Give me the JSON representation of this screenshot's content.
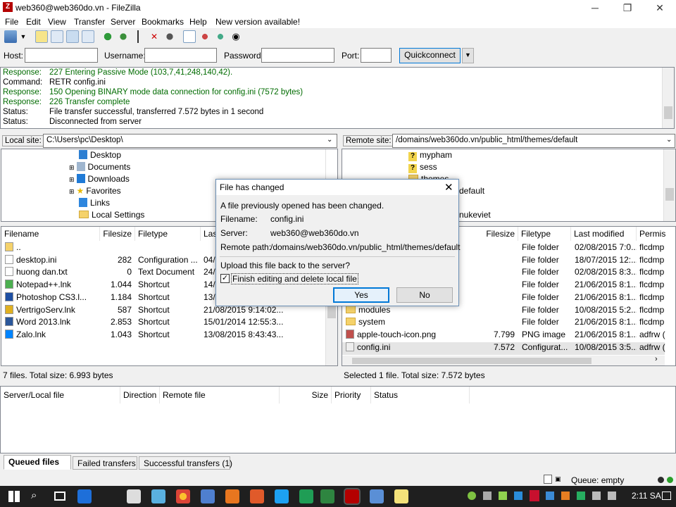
{
  "window": {
    "title": "web360@web360do.vn - FileZilla",
    "controls": [
      "─",
      "❐",
      "✕"
    ]
  },
  "menu": [
    "File",
    "Edit",
    "View",
    "Transfer",
    "Server",
    "Bookmarks",
    "Help",
    "New version available!"
  ],
  "quickconnect": {
    "host_label": "Host:",
    "username_label": "Username:",
    "password_label": "Password:",
    "port_label": "Port:",
    "button": "Quickconnect",
    "host": "",
    "username": "",
    "password": "",
    "port": ""
  },
  "log": [
    {
      "k": "Response:",
      "v": "227 Entering Passive Mode (103,7,41,248,140,42).",
      "green": true
    },
    {
      "k": "Command:",
      "v": "RETR config.ini",
      "green": false
    },
    {
      "k": "Response:",
      "v": "150 Opening BINARY mode data connection for config.ini (7572 bytes)",
      "green": true
    },
    {
      "k": "Response:",
      "v": "226 Transfer complete",
      "green": true
    },
    {
      "k": "Status:",
      "v": "File transfer successful, transferred 7.572 bytes in 1 second",
      "green": false
    },
    {
      "k": "Status:",
      "v": "Disconnected from server",
      "green": false
    }
  ],
  "local": {
    "label": "Local site:",
    "path": "C:\\Users\\pc\\Desktop\\",
    "tree": [
      "Desktop",
      "Documents",
      "Downloads",
      "Favorites",
      "Links",
      "Local Settings"
    ],
    "columns": [
      "Filename",
      "Filesize",
      "Filetype",
      "Last"
    ],
    "files": [
      {
        "name": "..",
        "size": "",
        "type": "",
        "modified": ""
      },
      {
        "name": "desktop.ini",
        "size": "282",
        "type": "Configuration ...",
        "modified": "04/0"
      },
      {
        "name": "huong dan.txt",
        "size": "0",
        "type": "Text Document",
        "modified": "24/0"
      },
      {
        "name": "Notepad++.lnk",
        "size": "1.044",
        "type": "Shortcut",
        "modified": "14/0"
      },
      {
        "name": "Photoshop CS3.l...",
        "size": "1.184",
        "type": "Shortcut",
        "modified": "13/0"
      },
      {
        "name": "VertrigoServ.lnk",
        "size": "587",
        "type": "Shortcut",
        "modified": "21/08/2015 9:14:02..."
      },
      {
        "name": "Word 2013.lnk",
        "size": "2.853",
        "type": "Shortcut",
        "modified": "15/01/2014 12:55:3..."
      },
      {
        "name": "Zalo.lnk",
        "size": "1.043",
        "type": "Shortcut",
        "modified": "13/08/2015 8:43:43..."
      }
    ],
    "status": "7 files. Total size: 6.993 bytes"
  },
  "remote": {
    "label": "Remote site:",
    "path": "/domains/web360do.vn/public_html/themes/default",
    "tree": [
      "mypham",
      "sess",
      "themes",
      "default",
      "nukeviet"
    ],
    "columns": [
      "Filesize",
      "Filetype",
      "Last modified",
      "Permis"
    ],
    "files": [
      {
        "name": "",
        "size": "",
        "type": "File folder",
        "modified": "02/08/2015 7:0...",
        "perm": "flcdmp"
      },
      {
        "name": "",
        "size": "",
        "type": "File folder",
        "modified": "18/07/2015 12:...",
        "perm": "flcdmp"
      },
      {
        "name": "",
        "size": "",
        "type": "File folder",
        "modified": "02/08/2015 8:3...",
        "perm": "flcdmp"
      },
      {
        "name": "",
        "size": "",
        "type": "File folder",
        "modified": "21/06/2015 8:1...",
        "perm": "flcdmp"
      },
      {
        "name": "",
        "size": "",
        "type": "File folder",
        "modified": "21/06/2015 8:1...",
        "perm": "flcdmp"
      },
      {
        "name": "modules",
        "size": "",
        "type": "File folder",
        "modified": "10/08/2015 5:2...",
        "perm": "flcdmp"
      },
      {
        "name": "system",
        "size": "",
        "type": "File folder",
        "modified": "21/06/2015 8:1...",
        "perm": "flcdmp"
      },
      {
        "name": "apple-touch-icon.png",
        "size": "7.799",
        "type": "PNG image",
        "modified": "21/06/2015 8:1...",
        "perm": "adfrw ("
      },
      {
        "name": "config.ini",
        "size": "7.572",
        "type": "Configurat...",
        "modified": "10/08/2015 3:5...",
        "perm": "adfrw ("
      }
    ],
    "status": "Selected 1 file. Total size: 7.572 bytes"
  },
  "queue": {
    "columns": [
      "Server/Local file",
      "Direction",
      "Remote file",
      "Size",
      "Priority",
      "Status"
    ]
  },
  "tabs": [
    "Queued files",
    "Failed transfers",
    "Successful transfers (1)"
  ],
  "queue_status": "Queue: empty",
  "dialog": {
    "title": "File has changed",
    "message": "A file previously opened has been changed.",
    "filename_label": "Filename:",
    "filename": "config.ini",
    "server_label": "Server:",
    "server": "web360@web360do.vn",
    "remote_label": "Remote path:",
    "remote_path": "/domains/web360do.vn/public_html/themes/default",
    "question": "Upload this file back to the server?",
    "checkbox_label": "Finish editing and delete local file",
    "checkbox_checked": true,
    "yes": "Yes",
    "no": "No"
  },
  "taskbar": {
    "time": "2:11 SA"
  },
  "colors": {
    "log_green": "#006b00",
    "taskbar": "#1f1f1f",
    "accent": "#0078d7"
  }
}
